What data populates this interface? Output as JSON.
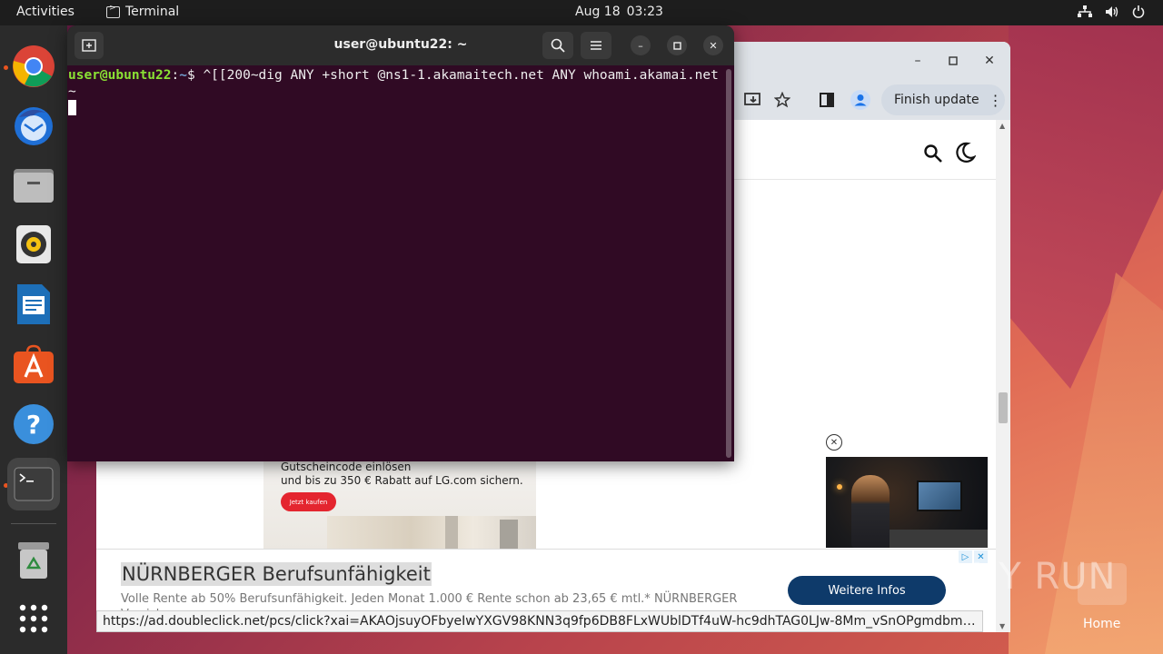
{
  "topbar": {
    "activities": "Activities",
    "app_name": "Terminal",
    "date": "Aug 18",
    "time": "03:23"
  },
  "dock": {
    "items": [
      "chrome-icon",
      "thunderbird-icon",
      "files-icon",
      "rhythmbox-icon",
      "libreoffice-writer-icon",
      "app-center-icon",
      "help-icon",
      "terminal-icon",
      "trash-icon",
      "show-apps-icon"
    ]
  },
  "browser": {
    "finish_update": "Finish update",
    "status_url": "https://ad.doubleclick.net/pcs/click?xai=AKAOjsuyOFbyeIwYXGV98KNN3q9fp6DB8FLxWUblDTf4uW-hc9dhTAG0LJw-8Mm_vSnOPgmdbm5..."
  },
  "ads": {
    "lg_line1": "Gutscheincode einlösen",
    "lg_line2": "und bis zu 350 € Rabatt auf LG.com sichern.",
    "lg_cta": "Jetzt kaufen",
    "bottom_headline": "NÜRNBERGER Berufsunfähigkeit",
    "bottom_desc": "Volle Rente ab 50% Berufsunfähigkeit. Jeden Monat 1.000 € Rente schon ab 23,65 € mtl.* NÜRNBERGER Versicherung",
    "bottom_button": "Weitere Infos"
  },
  "terminal": {
    "title": "user@ubuntu22: ~",
    "prompt_user": "user@ubuntu22",
    "prompt_sep": ":",
    "prompt_path": "~",
    "prompt_symbol": "$ ",
    "command": "^[[200~dig ANY +short @ns1-1.akamaitech.net ANY whoami.akamai.net~"
  },
  "watermark": {
    "text": "ANY RUN",
    "home_label": "Home"
  }
}
